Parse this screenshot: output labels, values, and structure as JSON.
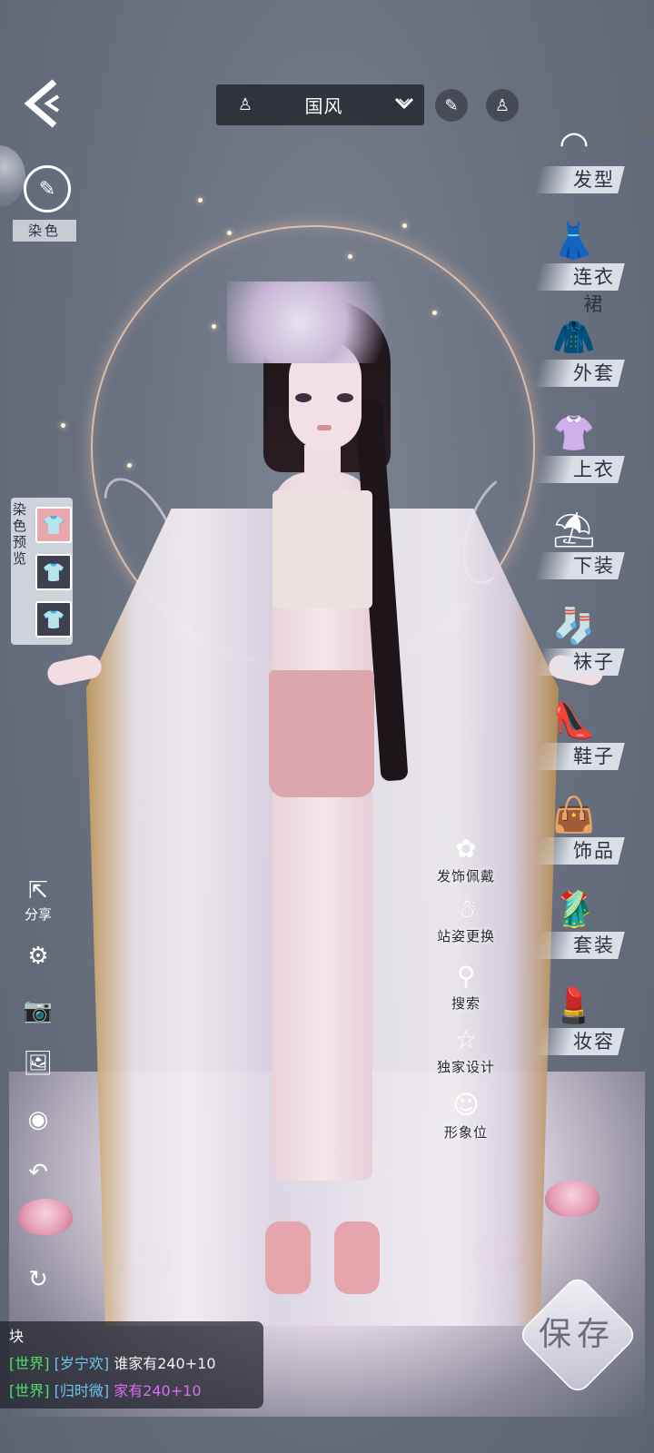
{
  "top_bar": {
    "style_value": "国风",
    "dress_icon": "dress-icon",
    "dropdown_icon": "chevron-down-icon",
    "buttons": [
      "brush-icon",
      "dress-icon"
    ]
  },
  "left_panel": {
    "dye_label": "染色",
    "dye_preview_label": "染色预览",
    "swatches": [
      "pink",
      "white",
      "white"
    ],
    "share_label": "分享"
  },
  "categories": [
    {
      "label": "发型",
      "icon": "hair-icon"
    },
    {
      "label": "连衣裙",
      "icon": "dress-icon"
    },
    {
      "label": "外套",
      "icon": "coat-icon"
    },
    {
      "label": "上衣",
      "icon": "shirt-icon"
    },
    {
      "label": "下装",
      "icon": "skirt-icon"
    },
    {
      "label": "袜子",
      "icon": "socks-icon"
    },
    {
      "label": "鞋子",
      "icon": "high-heel-icon"
    },
    {
      "label": "饰品",
      "icon": "bag-icon"
    },
    {
      "label": "套装",
      "icon": "suit-icon"
    },
    {
      "label": "妆容",
      "icon": "makeup-icon"
    }
  ],
  "actions": [
    {
      "label": "发饰佩戴",
      "icon": "hairpin-icon"
    },
    {
      "label": "站姿更换",
      "icon": "pose-icon"
    },
    {
      "label": "搜索",
      "icon": "search-icon"
    },
    {
      "label": "独家设计",
      "icon": "star-icon"
    },
    {
      "label": "形象位",
      "icon": "avatar-icon"
    }
  ],
  "save_label": "保存",
  "chat": {
    "first_line": "块",
    "messages": [
      {
        "channel": "[世界]",
        "name": "[岁宁欢]",
        "text": "谁家有240+10",
        "color": "#f2f2f2"
      },
      {
        "channel": "[世界]",
        "name": "[归时微]",
        "text": "家有240+10",
        "color": "#d86bf0"
      }
    ]
  },
  "colors": {
    "background": "#6b7382",
    "halo": "#ffd6be",
    "chat_channel": "#4fe06a",
    "chat_name": "#6fc4f0",
    "chat_highlight": "#d86bf0"
  }
}
